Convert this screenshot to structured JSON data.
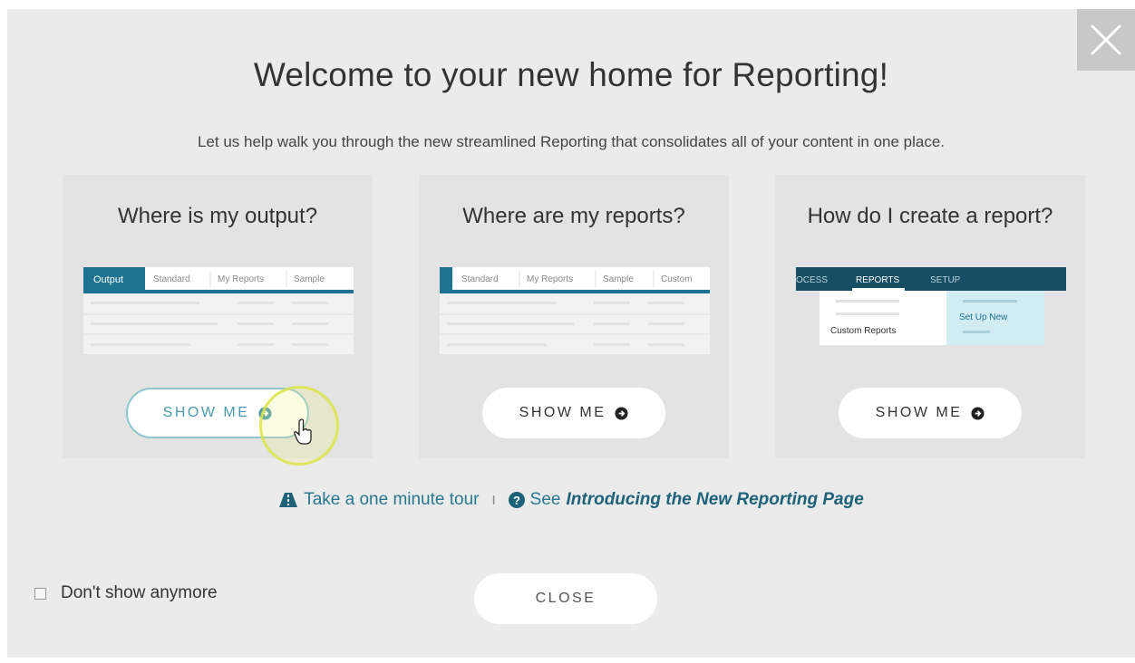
{
  "title": "Welcome to your new home for Reporting!",
  "subtitle": "Let us help walk you through the new streamlined Reporting that consolidates all of your content in one place.",
  "close_icon": "close-x-icon",
  "cards": [
    {
      "title": "Where is my output?",
      "button_label": "SHOW ME",
      "thumb": {
        "tabs": [
          "Output",
          "Standard",
          "My Reports",
          "Sample"
        ],
        "active_tab": "Output"
      }
    },
    {
      "title": "Where are my reports?",
      "button_label": "SHOW ME",
      "thumb": {
        "tabs": [
          "Standard",
          "My Reports",
          "Sample",
          "Custom"
        ]
      }
    },
    {
      "title": "How do I create a report?",
      "button_label": "SHOW ME",
      "thumb": {
        "nav": [
          "OCESS",
          "REPORTS",
          "SETUP"
        ],
        "menu_item": "Custom Reports",
        "side_item": "Set Up New"
      }
    }
  ],
  "links": {
    "tour_label": "Take a one minute tour",
    "separator": "I",
    "see_label": "See",
    "article_label": "Introducing the New Reporting Page"
  },
  "footer": {
    "dont_show_label": "Don't show anymore",
    "close_label": "CLOSE"
  },
  "colors": {
    "accent": "#1d6278",
    "tab_active": "#1e7391",
    "nav_dark": "#174e63",
    "link": "#26788e"
  }
}
